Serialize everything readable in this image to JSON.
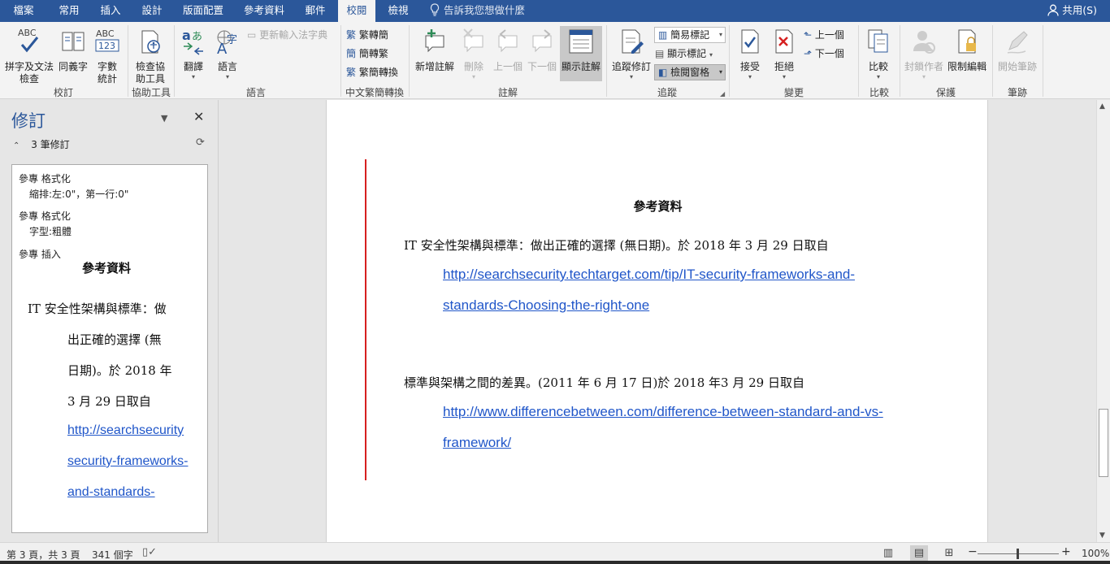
{
  "tabs": [
    {
      "id": "file",
      "label": "檔案",
      "active": false
    },
    {
      "id": "home",
      "label": "常用",
      "active": false
    },
    {
      "id": "insert",
      "label": "插入",
      "active": false
    },
    {
      "id": "design",
      "label": "設計",
      "active": false
    },
    {
      "id": "layout",
      "label": "版面配置",
      "active": false
    },
    {
      "id": "references",
      "label": "參考資料",
      "active": false
    },
    {
      "id": "mailings",
      "label": "郵件",
      "active": false
    },
    {
      "id": "review",
      "label": "校閱",
      "active": true
    },
    {
      "id": "view",
      "label": "檢視",
      "active": false
    }
  ],
  "tell_me": "告訴我您想做什麼",
  "share": "共用(S)",
  "ribbon": {
    "groups": {
      "proofing": "校訂",
      "accessibility": "協助工具",
      "language": "語言",
      "chinese_conversion": "中文繁簡轉換",
      "comments": "註解",
      "tracking": "追蹤",
      "changes": "變更",
      "compare": "比較",
      "protect": "保護",
      "ink": "筆跡"
    },
    "spelling": "拼字及文法\n檢查",
    "thesaurus": "同義字",
    "word_count": "字數\n統計",
    "check_accessibility": "檢查協\n助工具",
    "translate": "翻譯",
    "language": "語言",
    "update_ime": "更新輸入法字典",
    "trad_to_simp": "繁轉簡",
    "simp_to_trad": "簡轉繁",
    "convert": "繁簡轉換",
    "new_comment": "新增註解",
    "delete": "刪除",
    "previous_comment": "上一個",
    "next_comment": "下一個",
    "show_comments": "顯示註解",
    "track_changes": "追蹤修訂",
    "markup_mode": "簡易標記",
    "show_markup": "顯示標記",
    "reviewing_pane": "檢閱窗格",
    "accept": "接受",
    "reject": "拒絕",
    "previous_change": "上一個",
    "next_change": "下一個",
    "compare": "比較",
    "block_authors": "封鎖作者",
    "restrict_editing": "限制編輯",
    "start_inking": "開始筆跡"
  },
  "revisions_pane": {
    "title": "修訂",
    "count": "3 筆修訂",
    "items": [
      {
        "author_action": "參專 格式化",
        "detail": "縮排:左:0\"，第一行:0\""
      },
      {
        "author_action": "參專 格式化",
        "detail": "字型:粗體"
      },
      {
        "author_action": "參專 插入",
        "detail": ""
      }
    ],
    "inserted_heading": "參考資料",
    "inserted_lines": [
      "IT 安全性架構與標準：做",
      "出正確的選擇 (無",
      "日期)。於 2018 年",
      "3 月 29 日取自"
    ],
    "inserted_links": [
      "http://searchsecurity",
      "security-frameworks-",
      "and-standards-"
    ]
  },
  "document": {
    "heading": "參考資料",
    "ref1_text": "IT 安全性架構與標準：做出正確的選擇 (無日期)。於 2018 年 3 月 29 日取自",
    "ref1_link_line1": "http://searchsecurity.techtarget.com/tip/IT-security-frameworks-and-",
    "ref1_link_line2": "standards-Choosing-the-right-one",
    "ref2_text": "標準與架構之間的差異。(2011 年 6 月 17 日)於 2018 年3 月 29 日取自",
    "ref2_link_line1": "http://www.differencebetween.com/difference-between-standard-and-vs-",
    "ref2_link_line2": "framework/"
  },
  "status": {
    "page": "第 3 頁，共 3 頁",
    "words": "341 個字",
    "zoom": "100%"
  },
  "colors": {
    "accent": "#2b579a",
    "link": "#2056c9",
    "change_bar": "#d62020"
  }
}
